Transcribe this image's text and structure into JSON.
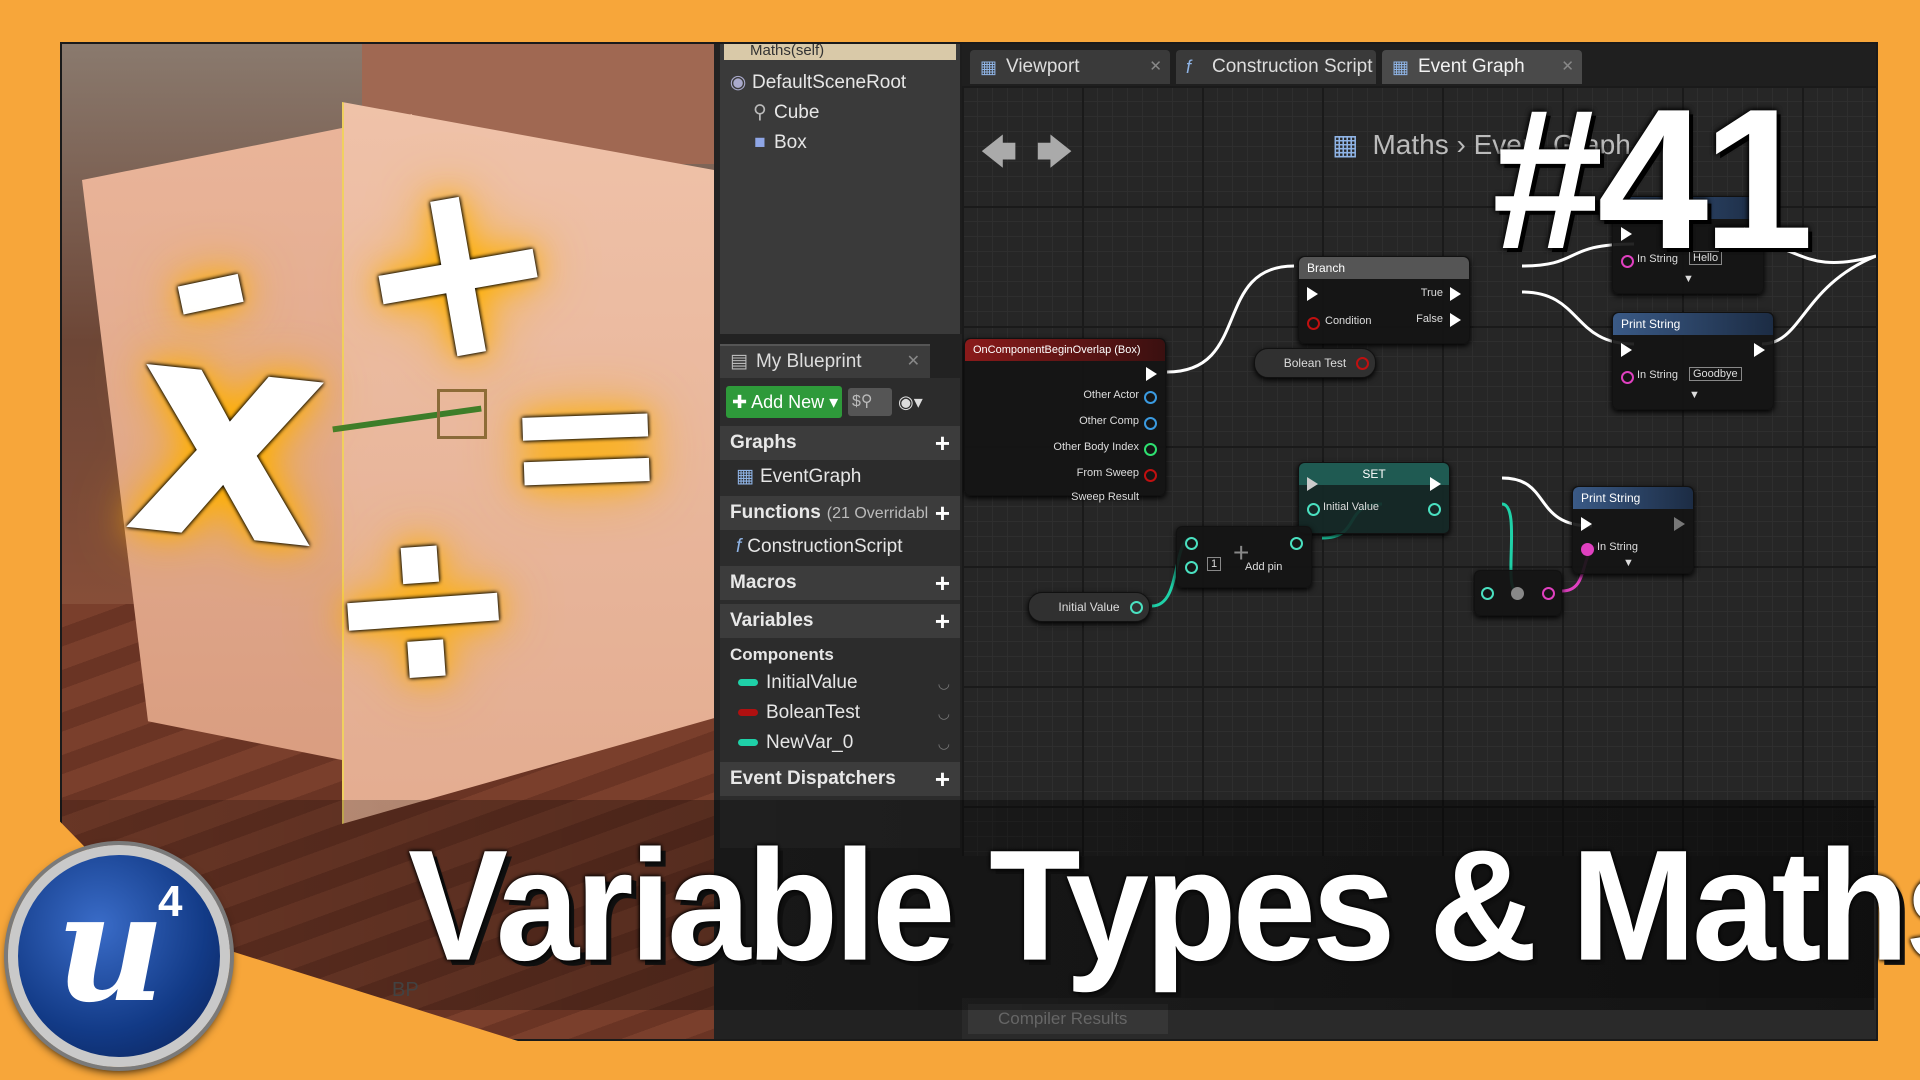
{
  "overlay": {
    "episode_number": "#41",
    "title": "Variable Types & Maths",
    "logo_text": "4"
  },
  "math_symbols": {
    "minus": "-",
    "plus": "+",
    "times": "x",
    "equals": "=",
    "divide": "÷"
  },
  "components_panel": {
    "header": "Maths(self)",
    "items": [
      "DefaultSceneRoot",
      "Cube",
      "Box"
    ]
  },
  "my_blueprint": {
    "tab_label": "My Blueprint",
    "add_new_label": "Add New",
    "sections": {
      "graphs": "Graphs",
      "functions": "Functions",
      "functions_sub": "(21 Overridabl",
      "macros": "Macros",
      "variables": "Variables",
      "components": "Components",
      "event_dispatchers": "Event Dispatchers"
    },
    "graph_items": [
      "EventGraph"
    ],
    "function_items": [
      "ConstructionScript"
    ],
    "variables": [
      {
        "name": "InitialValue",
        "color": "#1fd1a8"
      },
      {
        "name": "BoleanTest",
        "color": "#b01010"
      },
      {
        "name": "NewVar_0",
        "color": "#1fd1a8"
      }
    ]
  },
  "editor_tabs": [
    "Viewport",
    "Construction Script",
    "Event Graph"
  ],
  "breadcrumb": {
    "root": "Maths",
    "current": "Event Graph"
  },
  "graph": {
    "event_node": {
      "title": "OnComponentBeginOverlap (Box)",
      "pins": [
        "Other Actor",
        "Other Comp",
        "Other Body Index",
        "From Sweep",
        "Sweep Result"
      ]
    },
    "branch_node": {
      "title": "Branch",
      "condition": "Condition",
      "true_label": "True",
      "false_label": "False"
    },
    "print_top": {
      "title": "Print String",
      "in_string": "In String",
      "value": "Hello"
    },
    "print_mid": {
      "title": "Print String",
      "in_string": "In String",
      "value": "Goodbye"
    },
    "print_bottom": {
      "title": "Print String",
      "in_string": "In String"
    },
    "bool_var": "Bolean Test",
    "set_node": {
      "title": "SET",
      "pin": "Initial Value"
    },
    "add_node": {
      "value": "1",
      "add_pin": "Add pin"
    },
    "initial_value_getter": "Initial Value"
  },
  "compiler_results": "Compiler Results",
  "bg_breadcrumb": "BP"
}
